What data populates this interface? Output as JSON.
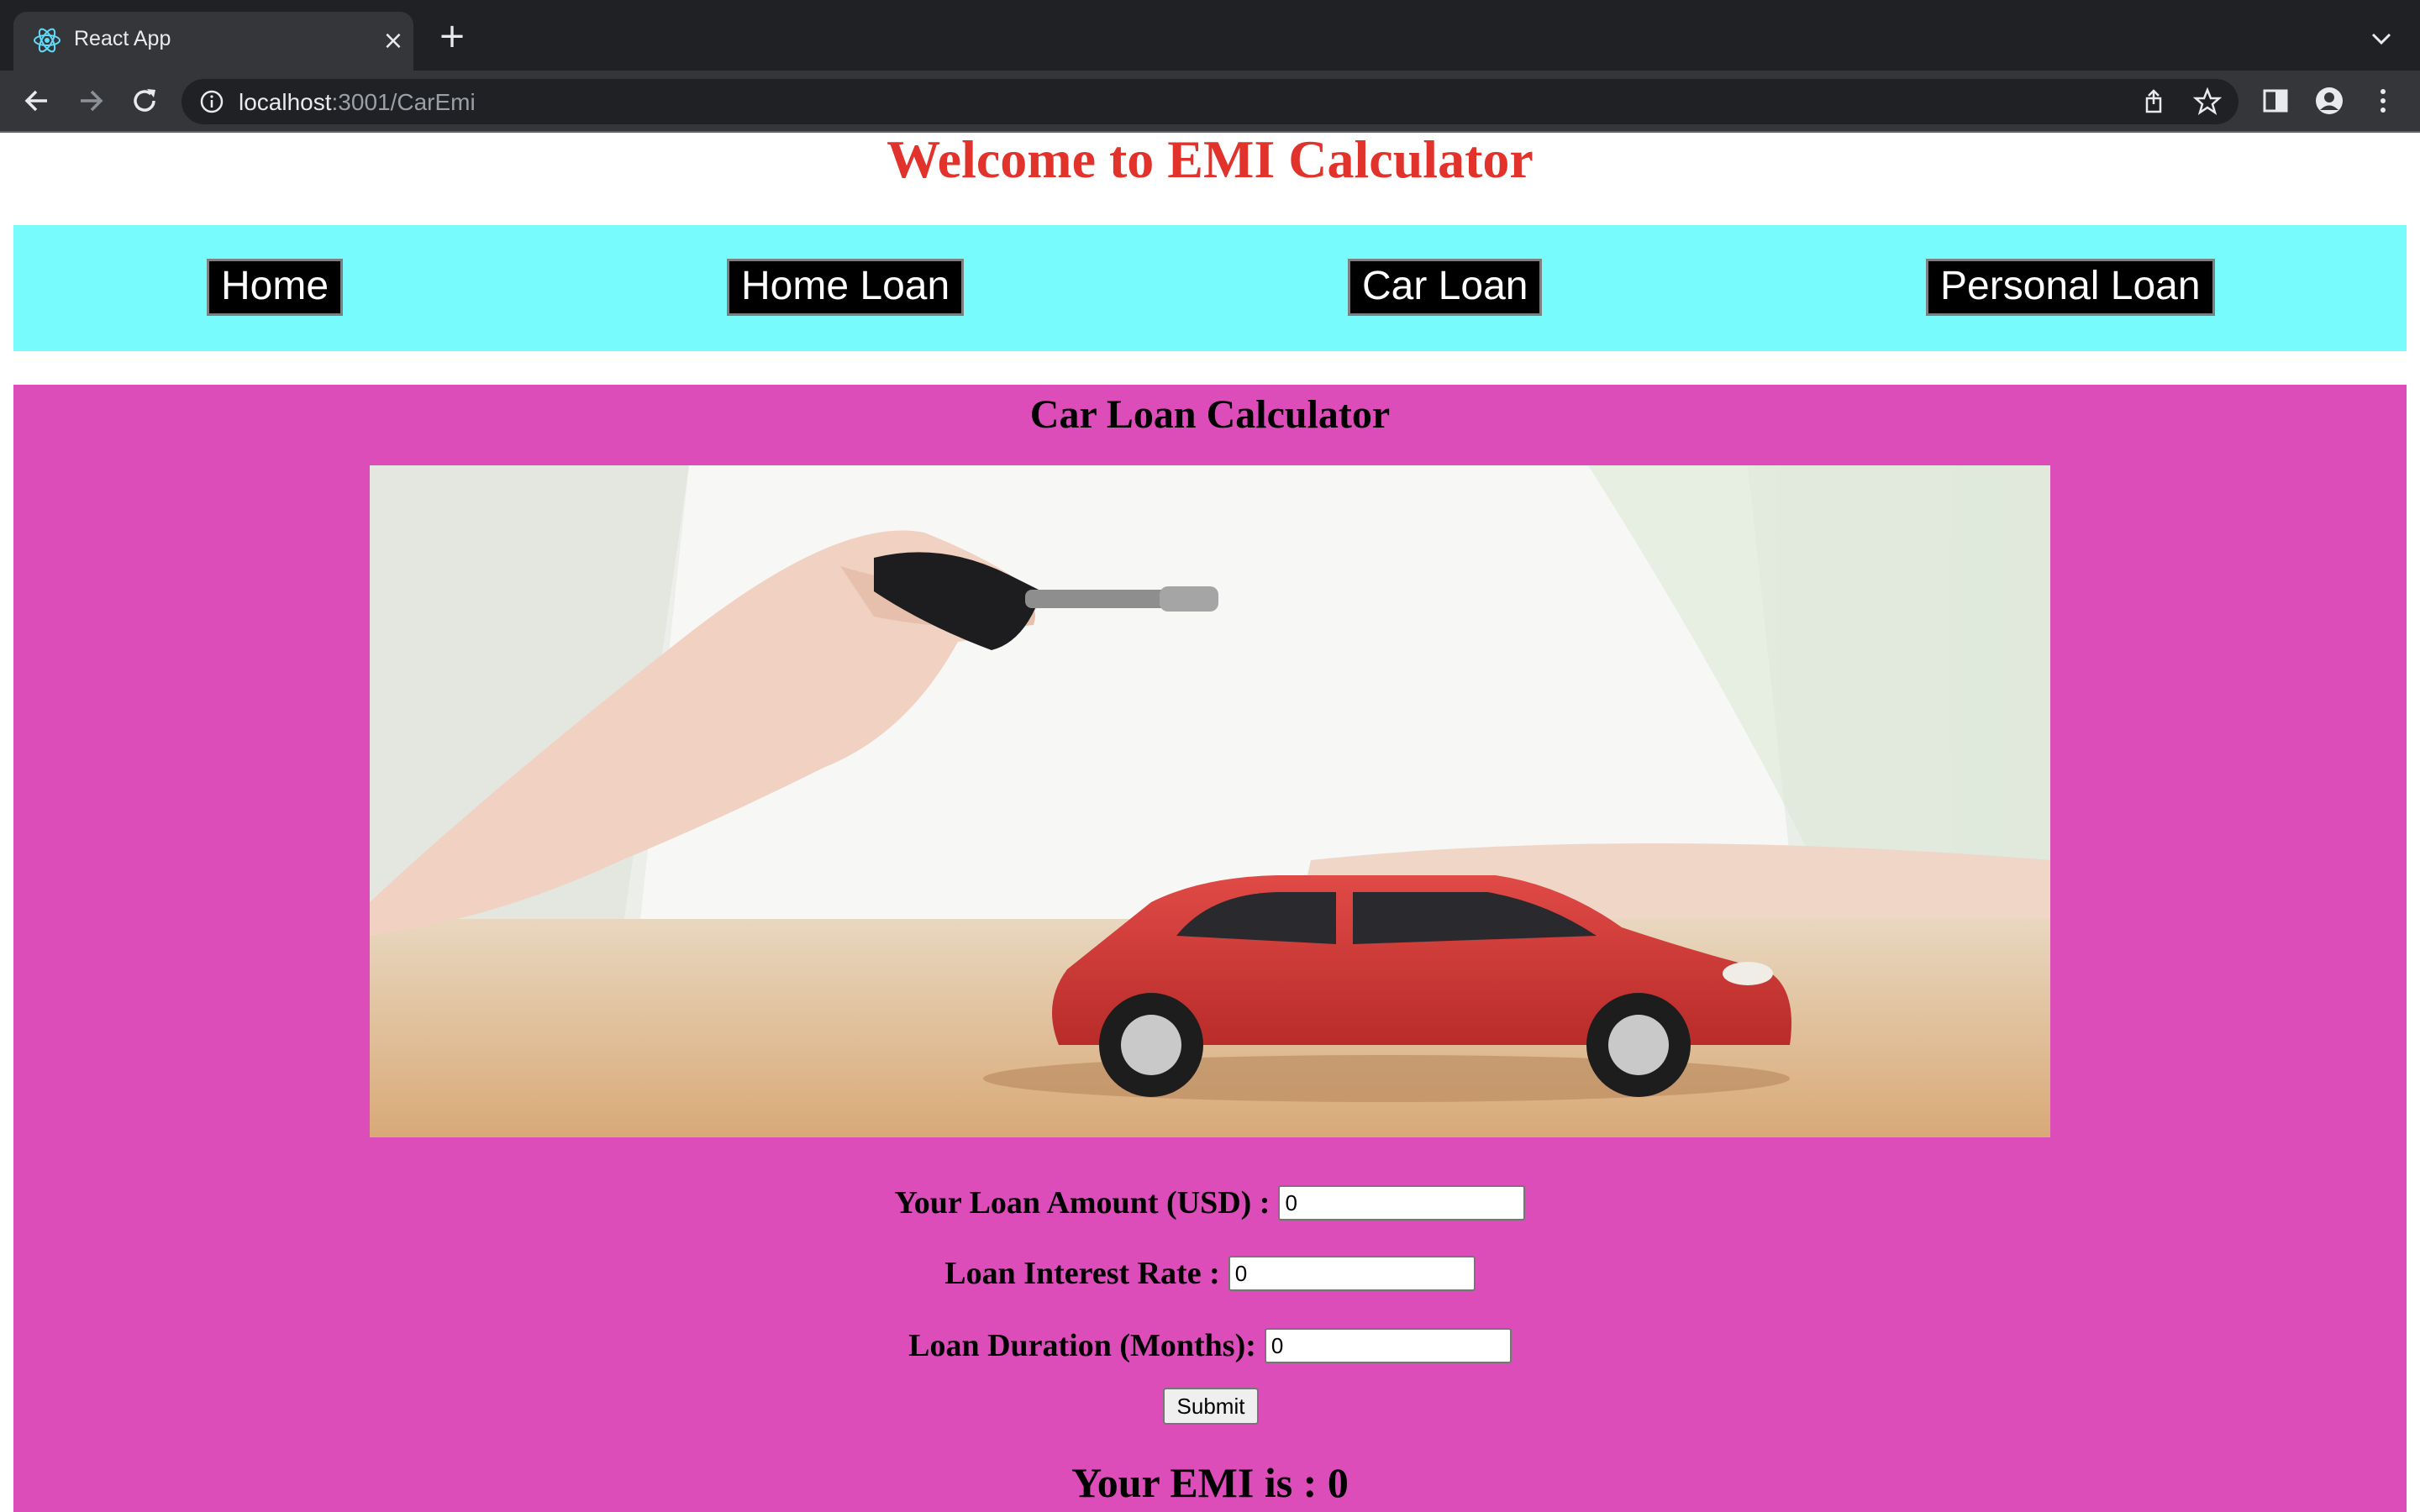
{
  "browser": {
    "tab_title": "React App",
    "url_host": "localhost",
    "url_rest": ":3001/CarEmi"
  },
  "page": {
    "welcome_heading": "Welcome to EMI Calculator",
    "nav": [
      "Home",
      "Home Loan",
      "Car Loan",
      "Personal Loan"
    ],
    "calculator_title": "Car Loan Calculator",
    "hero_image": "toy-red-car-with-car-key",
    "fields": {
      "amount_label": "Your Loan Amount (USD) :",
      "amount_value": "0",
      "rate_label": "Loan Interest Rate :",
      "rate_value": "0",
      "duration_label": "Loan Duration (Months):",
      "duration_value": "0"
    },
    "submit_label": "Submit",
    "emi_result": "Your EMI is : 0"
  },
  "colors": {
    "heading": "#e1322c",
    "navbar_bg": "#77fbfd",
    "calculator_bg": "#dc4db9"
  }
}
